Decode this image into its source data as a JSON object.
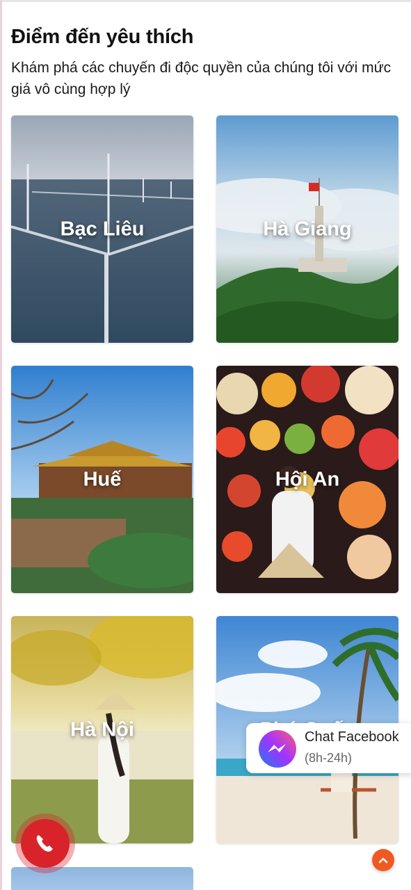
{
  "section": {
    "title": "Điểm đến yêu thích",
    "subtitle": "Khám phá các chuyến đi độc quyền của chúng tôi với mức giá vô cùng hợp lý"
  },
  "destinations": [
    {
      "name": "Bạc Liêu"
    },
    {
      "name": "Hà Giang"
    },
    {
      "name": "Huế"
    },
    {
      "name": "Hội An"
    },
    {
      "name": "Hà Nội"
    },
    {
      "name": "Phú Quốc"
    }
  ],
  "chat_widget": {
    "title": "Chat Facebook",
    "hours": "(8h-24h)",
    "icon": "messenger-icon"
  },
  "call_button": {
    "icon": "phone-icon",
    "color": "#d8232a"
  },
  "scroll_top_button": {
    "icon": "chevron-up-icon",
    "color": "#f05a22"
  }
}
